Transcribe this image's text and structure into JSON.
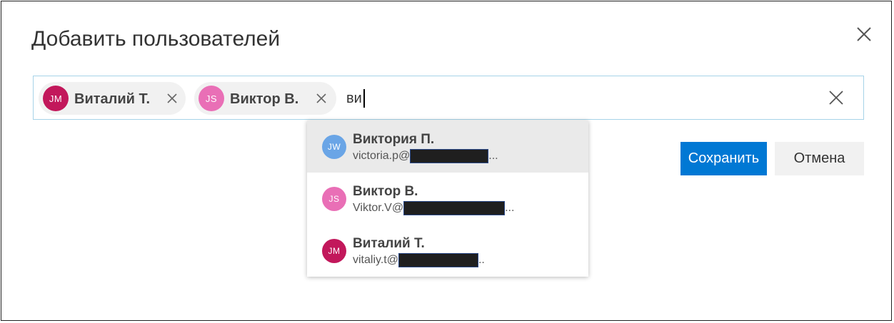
{
  "dialog": {
    "title": "Добавить пользователей",
    "close_icon": "close-icon"
  },
  "picker": {
    "selected": [
      {
        "initials": "JM",
        "name": "Виталий Т.",
        "color": "#c2185b",
        "remove_icon": "close-icon"
      },
      {
        "initials": "JS",
        "name": "Виктор В.",
        "color": "#e96fb6",
        "remove_icon": "close-icon"
      }
    ],
    "query": "ви",
    "clear_icon": "close-icon"
  },
  "suggestions": [
    {
      "initials": "JW",
      "name": "Виктория П.",
      "email_prefix": "victoria.p@",
      "email_suffix": "...",
      "color": "#6aa5e6",
      "selected": true
    },
    {
      "initials": "JS",
      "name": "Виктор В.",
      "email_prefix": "Viktor.V@",
      "email_suffix": "...",
      "color": "#e96fb6",
      "selected": false
    },
    {
      "initials": "JM",
      "name": "Виталий Т.",
      "email_prefix": "vitaliy.t@",
      "email_suffix": "..",
      "color": "#c2185b",
      "selected": false
    }
  ],
  "buttons": {
    "save": "Сохранить",
    "cancel": "Отмена"
  },
  "colors": {
    "accent": "#0078d4",
    "picker_border": "#a6d3e8"
  }
}
